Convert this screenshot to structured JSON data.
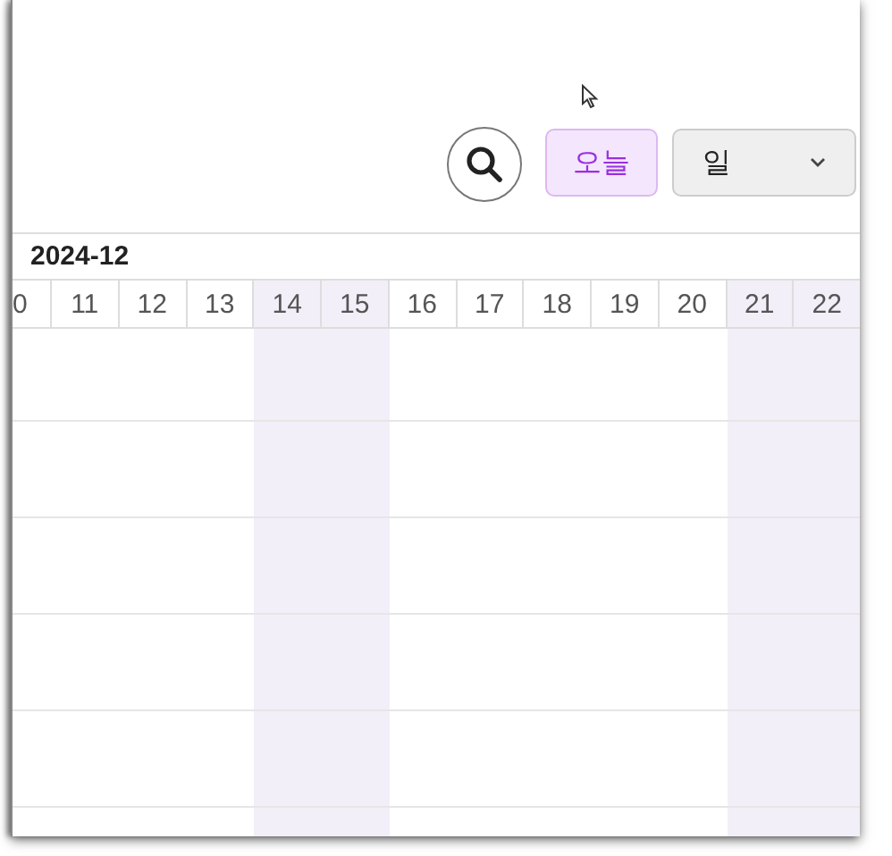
{
  "toolbar": {
    "today_button": "오늘",
    "view_select": {
      "value": "일"
    }
  },
  "month": "2024-12",
  "days": [
    {
      "label": "0",
      "weekend": false
    },
    {
      "label": "11",
      "weekend": false
    },
    {
      "label": "12",
      "weekend": false
    },
    {
      "label": "13",
      "weekend": false
    },
    {
      "label": "14",
      "weekend": true
    },
    {
      "label": "15",
      "weekend": true
    },
    {
      "label": "16",
      "weekend": false
    },
    {
      "label": "17",
      "weekend": false
    },
    {
      "label": "18",
      "weekend": false
    },
    {
      "label": "19",
      "weekend": false
    },
    {
      "label": "20",
      "weekend": false
    },
    {
      "label": "21",
      "weekend": true
    },
    {
      "label": "22",
      "weekend": true
    }
  ]
}
